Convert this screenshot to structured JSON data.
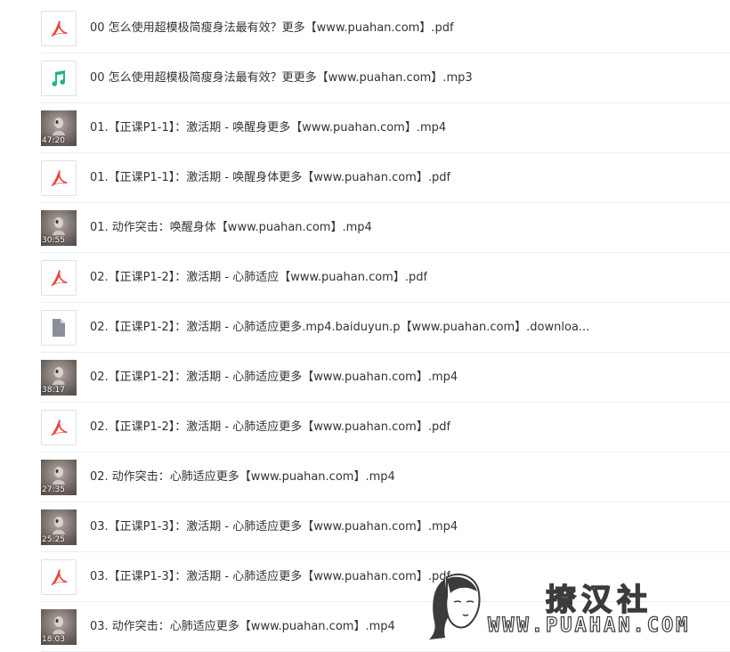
{
  "colors": {
    "pdf_icon": "#e8453c",
    "audio_icon": "#24b47e",
    "generic_icon": "#8a8f99",
    "text": "#333333",
    "divider": "#ebeef3"
  },
  "files": [
    {
      "type": "pdf",
      "icon": "pdf-icon",
      "name": "00 怎么使用超模极简瘦身法最有效？更多【www.puahan.com】.pdf"
    },
    {
      "type": "audio",
      "icon": "music-note-icon",
      "name": "00 怎么使用超模极简瘦身法最有效？更更多【www.puahan.com】.mp3"
    },
    {
      "type": "video",
      "icon": "video-thumbnail",
      "duration": "47:20",
      "name": "01.【正课P1-1】：激活期 - 唤醒身更多【www.puahan.com】.mp4"
    },
    {
      "type": "pdf",
      "icon": "pdf-icon",
      "name": "01.【正课P1-1】：激活期 - 唤醒身体更多【www.puahan.com】.pdf"
    },
    {
      "type": "video",
      "icon": "video-thumbnail",
      "duration": "30:55",
      "name": "01. 动作突击：唤醒身体【www.puahan.com】.mp4"
    },
    {
      "type": "pdf",
      "icon": "pdf-icon",
      "name": "02.【正课P1-2】：激活期 - 心肺适应【www.puahan.com】.pdf"
    },
    {
      "type": "generic",
      "icon": "file-icon",
      "name": "02.【正课P1-2】：激活期 - 心肺适应更多.mp4.baiduyun.p【www.puahan.com】.downloa..."
    },
    {
      "type": "video",
      "icon": "video-thumbnail",
      "duration": "38:17",
      "name": "02.【正课P1-2】：激活期 - 心肺适应更多【www.puahan.com】.mp4"
    },
    {
      "type": "pdf",
      "icon": "pdf-icon",
      "name": "02.【正课P1-2】：激活期 - 心肺适应更多【www.puahan.com】.pdf"
    },
    {
      "type": "video",
      "icon": "video-thumbnail",
      "duration": "27:35",
      "name": "02. 动作突击：心肺适应更多【www.puahan.com】.mp4"
    },
    {
      "type": "video",
      "icon": "video-thumbnail",
      "duration": "25:25",
      "name": "03.【正课P1-3】：激活期 - 心肺适应更多【www.puahan.com】.mp4"
    },
    {
      "type": "pdf",
      "icon": "pdf-icon",
      "name": "03.【正课P1-3】：激活期 - 心肺适应更多【www.puahan.com】.pdf"
    },
    {
      "type": "video",
      "icon": "video-thumbnail",
      "duration": "18:03",
      "name": "03. 动作突击：心肺适应更多【www.puahan.com】.mp4"
    }
  ],
  "watermark": {
    "chinese": "撩汉社",
    "url": "WWW.PUAHAN.COM"
  }
}
